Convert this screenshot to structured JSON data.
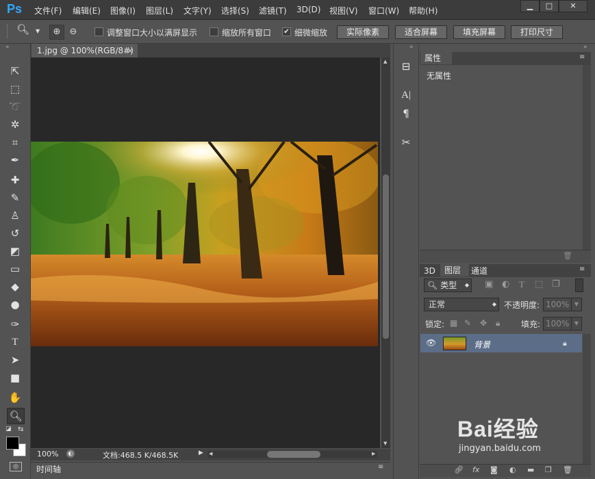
{
  "app": {
    "logo": "Ps"
  },
  "menu": [
    "文件(F)",
    "编辑(E)",
    "图像(I)",
    "图层(L)",
    "文字(Y)",
    "选择(S)",
    "滤镜(T)",
    "3D(D)",
    "视图(V)",
    "窗口(W)",
    "帮助(H)"
  ],
  "window_controls": {
    "minimize": "▁",
    "maximize": "□",
    "close": "✕"
  },
  "options": {
    "resize_windows": "调整窗口大小以满屏显示",
    "zoom_all": "缩放所有窗口",
    "scrubby_zoom": "细微缩放",
    "actual_pixels": "实际像素",
    "fit_screen": "适合屏幕",
    "fill_screen": "填充屏幕",
    "print_size": "打印尺寸"
  },
  "document": {
    "tab_title": "1.jpg @ 100%(RGB/8#)",
    "tab_close": "×",
    "zoom": "100%",
    "doc_info": "文档:468.5 K/468.5K"
  },
  "timeline_label": "时间轴",
  "properties": {
    "tab": "属性",
    "empty": "无属性"
  },
  "layers": {
    "tabs": [
      "3D",
      "图层",
      "通道"
    ],
    "filter": "类型",
    "blend_mode": "正常",
    "opacity_label": "不透明度:",
    "opacity_value": "100%",
    "lock_label": "锁定:",
    "fill_label": "填充:",
    "fill_value": "100%",
    "layer_name": "背景"
  },
  "watermark": {
    "brand": "Bai经验",
    "url": "jingyan.baidu.com"
  },
  "colors": {
    "accent": "#31a8ff",
    "selected_layer": "#5c6d88",
    "canvas_bg": "#282828"
  }
}
